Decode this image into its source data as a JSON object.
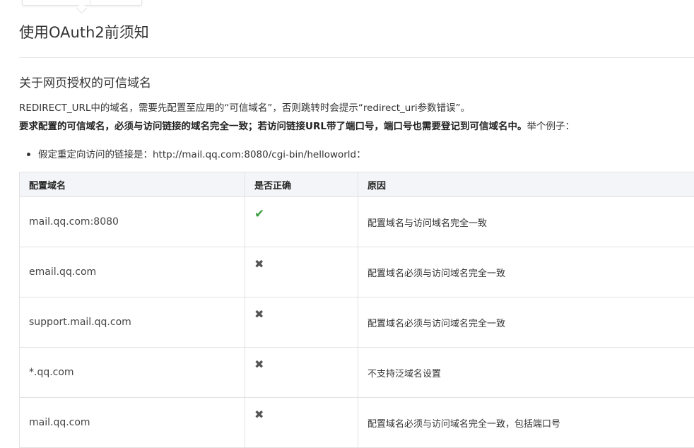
{
  "page": {
    "title": "使用OAuth2前须知",
    "section_title": "关于网页授权的可信域名",
    "para1": "REDIRECT_URL中的域名，需要先配置至应用的“可信域名”，否则跳转时会提示“redirect_uri参数错误”。",
    "para2_bold": "要求配置的可信域名，必须与访问链接的域名完全一致；若访问链接URL带了端口号，端口号也需要登记到可信域名中。",
    "para2_rest": "举个例子：",
    "bullet": "假定重定向访问的链接是：http://mail.qq.com:8080/cgi-bin/helloworld："
  },
  "table": {
    "headers": [
      "配置域名",
      "是否正确",
      "原因"
    ],
    "rows": [
      {
        "domain": "mail.qq.com:8080",
        "correct_icon": "✔",
        "icon_name": "check-icon",
        "reason": "配置域名与访问域名完全一致"
      },
      {
        "domain": "email.qq.com",
        "correct_icon": "✖",
        "icon_name": "cross-icon",
        "reason": "配置域名必须与访问域名完全一致"
      },
      {
        "domain": "support.mail.qq.com",
        "correct_icon": "✖",
        "icon_name": "cross-icon",
        "reason": "配置域名必须与访问域名完全一致"
      },
      {
        "domain": "*.qq.com",
        "correct_icon": "✖",
        "icon_name": "cross-icon",
        "reason": "不支持泛域名设置"
      },
      {
        "domain": "mail.qq.com",
        "correct_icon": "✖",
        "icon_name": "cross-icon",
        "reason": "配置域名必须与访问域名完全一致，包括端口号"
      }
    ]
  },
  "colors": {
    "check": "#3c9e44",
    "cross": "#555555",
    "header_bg": "#f4f5f9"
  }
}
